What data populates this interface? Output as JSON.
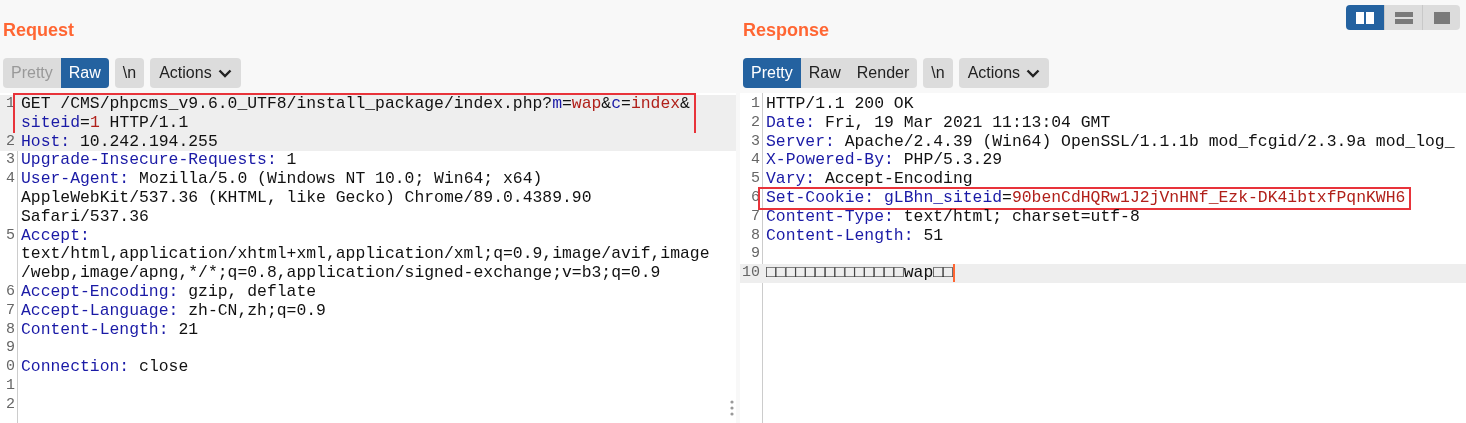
{
  "layout_buttons": [
    {
      "kind": "columns",
      "selected": true
    },
    {
      "kind": "rows",
      "selected": false
    },
    {
      "kind": "single",
      "selected": false
    }
  ],
  "panels": [
    {
      "title": "Request",
      "tabs": [
        {
          "label": "Pretty",
          "selected": false,
          "disabled": true
        },
        {
          "label": "Raw",
          "selected": true,
          "disabled": false
        }
      ],
      "newline_button": "\\n",
      "actions": "Actions",
      "lines": [
        {
          "number": "1",
          "highlighted": true,
          "boxed": true,
          "cursor": false,
          "wrapped": [
            {
              "parts": [
                {
                  "text": "GET /CMS/phpcms_v9.6.0_UTF8/install_package/index.php?",
                  "kind": "plain"
                },
                {
                  "text": "m",
                  "kind": "name"
                },
                {
                  "text": "=",
                  "kind": "plain"
                },
                {
                  "text": "wap",
                  "kind": "value"
                },
                {
                  "text": "&",
                  "kind": "plain"
                },
                {
                  "text": "c",
                  "kind": "name"
                },
                {
                  "text": "=",
                  "kind": "plain"
                },
                {
                  "text": "index",
                  "kind": "value"
                },
                {
                  "text": "&",
                  "kind": "plain"
                }
              ]
            },
            {
              "parts": [
                {
                  "text": "siteid",
                  "kind": "name"
                },
                {
                  "text": "=",
                  "kind": "plain"
                },
                {
                  "text": "1",
                  "kind": "value"
                },
                {
                  "text": " HTTP/1.1",
                  "kind": "plain"
                }
              ]
            }
          ]
        },
        {
          "number": "2",
          "highlighted": true,
          "boxed": false,
          "cursor": false,
          "wrapped": [
            {
              "parts": [
                {
                  "text": "Host:",
                  "kind": "name"
                },
                {
                  "text": " 10.242.194.255",
                  "kind": "plain"
                }
              ]
            }
          ]
        },
        {
          "number": "3",
          "highlighted": false,
          "boxed": false,
          "cursor": false,
          "wrapped": [
            {
              "parts": [
                {
                  "text": "Upgrade-Insecure-Requests:",
                  "kind": "name"
                },
                {
                  "text": " 1",
                  "kind": "plain"
                }
              ]
            }
          ]
        },
        {
          "number": "4",
          "highlighted": false,
          "boxed": false,
          "cursor": false,
          "wrapped": [
            {
              "parts": [
                {
                  "text": "User-Agent:",
                  "kind": "name"
                },
                {
                  "text": " Mozilla/5.0 (Windows NT 10.0; Win64; x64)",
                  "kind": "plain"
                }
              ]
            },
            {
              "parts": [
                {
                  "text": "AppleWebKit/537.36 (KHTML, like Gecko) Chrome/89.0.4389.90",
                  "kind": "plain"
                }
              ]
            },
            {
              "parts": [
                {
                  "text": "Safari/537.36",
                  "kind": "plain"
                }
              ]
            }
          ]
        },
        {
          "number": "5",
          "highlighted": false,
          "boxed": false,
          "cursor": false,
          "wrapped": [
            {
              "parts": [
                {
                  "text": "Accept:",
                  "kind": "name"
                }
              ]
            },
            {
              "parts": [
                {
                  "text": "text/html,application/xhtml+xml,application/xml;q=0.9,image/avif,image",
                  "kind": "plain"
                }
              ]
            },
            {
              "parts": [
                {
                  "text": "/webp,image/apng,*/*;q=0.8,application/signed-exchange;v=b3;q=0.9",
                  "kind": "plain"
                }
              ]
            }
          ]
        },
        {
          "number": "6",
          "highlighted": false,
          "boxed": false,
          "cursor": false,
          "wrapped": [
            {
              "parts": [
                {
                  "text": "Accept-Encoding:",
                  "kind": "name"
                },
                {
                  "text": " gzip, deflate",
                  "kind": "plain"
                }
              ]
            }
          ]
        },
        {
          "number": "7",
          "highlighted": false,
          "boxed": false,
          "cursor": false,
          "wrapped": [
            {
              "parts": [
                {
                  "text": "Accept-Language:",
                  "kind": "name"
                },
                {
                  "text": " zh-CN,zh;q=0.9",
                  "kind": "plain"
                }
              ]
            }
          ]
        },
        {
          "number": "8",
          "highlighted": false,
          "boxed": false,
          "cursor": false,
          "wrapped": [
            {
              "parts": [
                {
                  "text": "Content-Length:",
                  "kind": "name"
                },
                {
                  "text": " 21",
                  "kind": "plain"
                }
              ]
            }
          ]
        },
        {
          "number": "9",
          "highlighted": false,
          "boxed": false,
          "cursor": false
        },
        {
          "number": "0",
          "highlighted": false,
          "boxed": false,
          "cursor": false,
          "wrapped": [
            {
              "parts": [
                {
                  "text": "Connection:",
                  "kind": "name"
                },
                {
                  "text": " close",
                  "kind": "plain"
                }
              ]
            }
          ]
        },
        {
          "number": "1",
          "highlighted": false,
          "boxed": false,
          "cursor": false
        },
        {
          "number": "2",
          "highlighted": false,
          "boxed": false,
          "cursor": false
        }
      ]
    },
    {
      "title": "Response",
      "tabs": [
        {
          "label": "Pretty",
          "selected": true,
          "disabled": false
        },
        {
          "label": "Raw",
          "selected": false,
          "disabled": false
        },
        {
          "label": "Render",
          "selected": false,
          "disabled": false
        }
      ],
      "newline_button": "\\n",
      "actions": "Actions",
      "lines": [
        {
          "number": "1",
          "highlighted": false,
          "boxed": false,
          "cursor": false,
          "wrapped": [
            {
              "parts": [
                {
                  "text": "HTTP/1.1 200 OK",
                  "kind": "plain"
                }
              ]
            }
          ]
        },
        {
          "number": "2",
          "highlighted": false,
          "boxed": false,
          "cursor": false,
          "wrapped": [
            {
              "parts": [
                {
                  "text": "Date:",
                  "kind": "name"
                },
                {
                  "text": " Fri, 19 Mar 2021 11:13:04 GMT",
                  "kind": "plain"
                }
              ]
            }
          ]
        },
        {
          "number": "3",
          "highlighted": false,
          "boxed": false,
          "cursor": false,
          "wrapped": [
            {
              "parts": [
                {
                  "text": "Server:",
                  "kind": "name"
                },
                {
                  "text": " Apache/2.4.39 (Win64) OpenSSL/1.1.1b mod_fcgid/2.3.9a mod_log_",
                  "kind": "plain"
                }
              ]
            }
          ]
        },
        {
          "number": "4",
          "highlighted": false,
          "boxed": false,
          "cursor": false,
          "wrapped": [
            {
              "parts": [
                {
                  "text": "X-Powered-By:",
                  "kind": "name"
                },
                {
                  "text": " PHP/5.3.29",
                  "kind": "plain"
                }
              ]
            }
          ]
        },
        {
          "number": "5",
          "highlighted": false,
          "boxed": false,
          "cursor": false,
          "wrapped": [
            {
              "parts": [
                {
                  "text": "Vary:",
                  "kind": "name"
                },
                {
                  "text": " Accept-Encoding",
                  "kind": "plain"
                }
              ]
            }
          ]
        },
        {
          "number": "6",
          "highlighted": false,
          "boxed": true,
          "cursor": false,
          "wrapped": [
            {
              "parts": [
                {
                  "text": "Set-Cookie: gLBhn_siteid",
                  "kind": "name"
                },
                {
                  "text": "=",
                  "kind": "plain"
                },
                {
                  "text": "90benCdHQRw1J2jVnHNf_Ezk-DK4ibtxfPqnKWH6",
                  "kind": "value"
                }
              ]
            }
          ]
        },
        {
          "number": "7",
          "highlighted": false,
          "boxed": false,
          "cursor": false,
          "wrapped": [
            {
              "parts": [
                {
                  "text": "Content-Type:",
                  "kind": "name"
                },
                {
                  "text": " text/html; charset=utf-8",
                  "kind": "plain"
                }
              ]
            }
          ]
        },
        {
          "number": "8",
          "highlighted": false,
          "boxed": false,
          "cursor": false,
          "wrapped": [
            {
              "parts": [
                {
                  "text": "Content-Length:",
                  "kind": "name"
                },
                {
                  "text": " 51",
                  "kind": "plain"
                }
              ]
            }
          ]
        },
        {
          "number": "9",
          "highlighted": false,
          "boxed": false,
          "cursor": false
        },
        {
          "number": "10",
          "highlighted": true,
          "boxed": false,
          "cursor": true,
          "wrapped": [
            {
              "parts": [
                {
                  "text": "□□□□□□□□□□□□□□wap□□",
                  "kind": "plain"
                }
              ]
            }
          ]
        }
      ]
    }
  ]
}
